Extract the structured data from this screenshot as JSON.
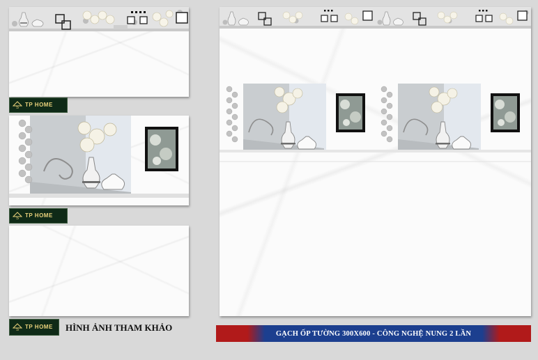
{
  "brand": {
    "name": "TP HOME"
  },
  "caption": "HÌNH ẢNH THAM KHẢO",
  "banner": "GẠCH ỐP TƯỜNG 300X600 - CÔNG NGHỆ NUNG 2 LẦN",
  "colors": {
    "background": "#d9d9d9",
    "banner_blue": "#1c3f8f",
    "banner_red": "#b11a1a",
    "logo_bg": "#0f2a17",
    "logo_gold": "#e8d07a"
  }
}
